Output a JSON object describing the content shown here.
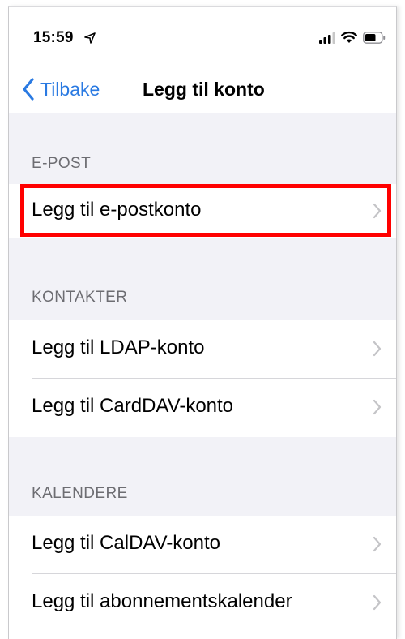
{
  "status_bar": {
    "time": "15:59"
  },
  "nav": {
    "back_label": "Tilbake",
    "title": "Legg til konto"
  },
  "sections": {
    "email": {
      "header": "E-POST",
      "rows": [
        "Legg til e-postkonto"
      ]
    },
    "contacts": {
      "header": "KONTAKTER",
      "rows": [
        "Legg til LDAP-konto",
        "Legg til CardDAV-konto"
      ]
    },
    "calendars": {
      "header": "KALENDERE",
      "rows": [
        "Legg til CalDAV-konto",
        "Legg til abonnementskalender"
      ]
    }
  },
  "colors": {
    "accent": "#2a7ae2",
    "highlight": "#ff0000",
    "background": "#f2f2f7"
  },
  "icons": [
    "location-arrow-icon",
    "cellular-signal-icon",
    "wifi-icon",
    "battery-icon",
    "chevron-left-icon",
    "chevron-right-icon"
  ]
}
